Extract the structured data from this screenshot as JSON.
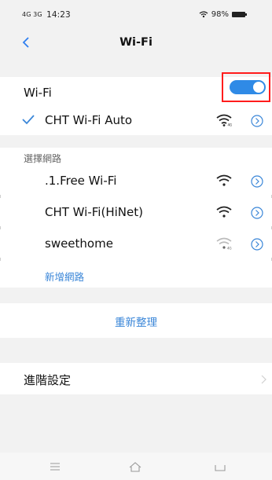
{
  "status_bar": {
    "network": "4G 3G",
    "time": "14:23",
    "battery": "98%"
  },
  "header": {
    "title": "Wi-Fi"
  },
  "wifi_toggle": {
    "label": "Wi-Fi",
    "enabled": true
  },
  "connected": {
    "name": "CHT Wi-Fi Auto"
  },
  "section": {
    "label": "選擇網路"
  },
  "networks": [
    {
      "name": ".1.Free Wi-Fi"
    },
    {
      "name": "CHT Wi-Fi(HiNet)"
    },
    {
      "name": "sweethome"
    }
  ],
  "add_network": {
    "label": "新增網路"
  },
  "refresh": {
    "label": "重新整理"
  },
  "advanced": {
    "label": "進階設定"
  },
  "colors": {
    "accent": "#3a86d8",
    "toggle": "#2f8ae6",
    "highlight": "#ff1c1c",
    "background": "#f2f2f2"
  }
}
